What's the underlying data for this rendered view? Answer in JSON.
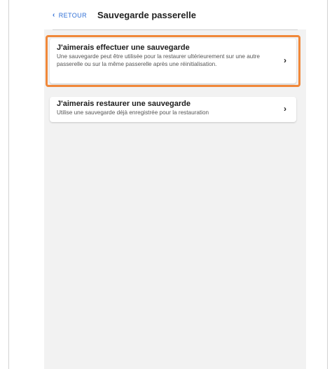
{
  "header": {
    "back_label": "RETOUR",
    "title": "Sauvegarde passerelle"
  },
  "options": [
    {
      "title": "J'aimerais effectuer une sauvegarde",
      "description": "Une sauvegarde peut être utilisée pour la restaurer ultérieurement sur une autre passerelle ou sur la même passerelle après une réinitialisation.",
      "icon": "chevron-right-icon"
    },
    {
      "title": "J'aimerais restaurer une sauvegarde",
      "description": "Utilise une sauvegarde déjà enregistrée pour la restauration",
      "icon": "chevron-right-icon"
    }
  ],
  "colors": {
    "accent": "#2f6fd6",
    "highlight": "#f0883a",
    "background": "#f2f2f2"
  }
}
